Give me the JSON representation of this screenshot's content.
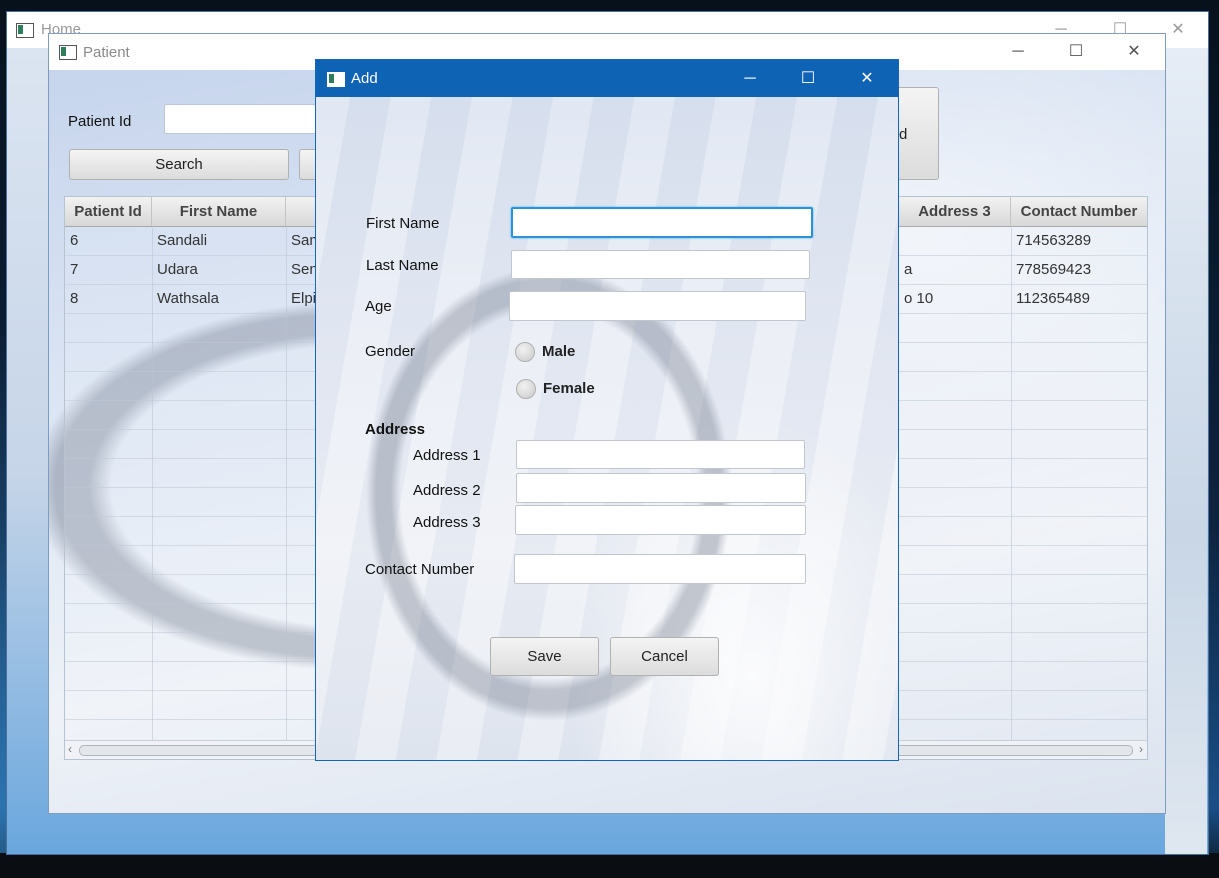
{
  "home": {
    "title": "Home"
  },
  "patient": {
    "title": "Patient",
    "patient_id_label": "Patient Id",
    "patient_id_value": "",
    "search_label": "Search",
    "right_button_fragment": "d",
    "table": {
      "headers": [
        "Patient Id",
        "First Name",
        "",
        "Address 3",
        "Contact Number"
      ],
      "rows": [
        [
          "6",
          "Sandali",
          "Sam",
          "",
          "714563289"
        ],
        [
          "7",
          "Udara",
          "Sena",
          "a",
          "778569423"
        ],
        [
          "8",
          "Wathsala",
          "Elpit",
          "o 10",
          "112365489"
        ]
      ]
    }
  },
  "add": {
    "title": "Add",
    "first_name_label": "First Name",
    "last_name_label": "Last Name",
    "age_label": "Age",
    "gender_label": "Gender",
    "gender_options": [
      "Male",
      "Female"
    ],
    "address_heading": "Address",
    "address1_label": "Address 1",
    "address2_label": "Address 2",
    "address3_label": "Address 3",
    "contact_label": "Contact Number",
    "save_label": "Save",
    "cancel_label": "Cancel",
    "values": {
      "first_name": "",
      "last_name": "",
      "age": "",
      "address1": "",
      "address2": "",
      "address3": "",
      "contact": ""
    }
  },
  "icons": {
    "minimize": "─",
    "maximize": "☐",
    "close": "✕",
    "scroll_left": "‹",
    "scroll_right": "›"
  },
  "colors": {
    "dialog_titlebar": "#0e63b5",
    "focus_ring": "#2a93d5"
  }
}
